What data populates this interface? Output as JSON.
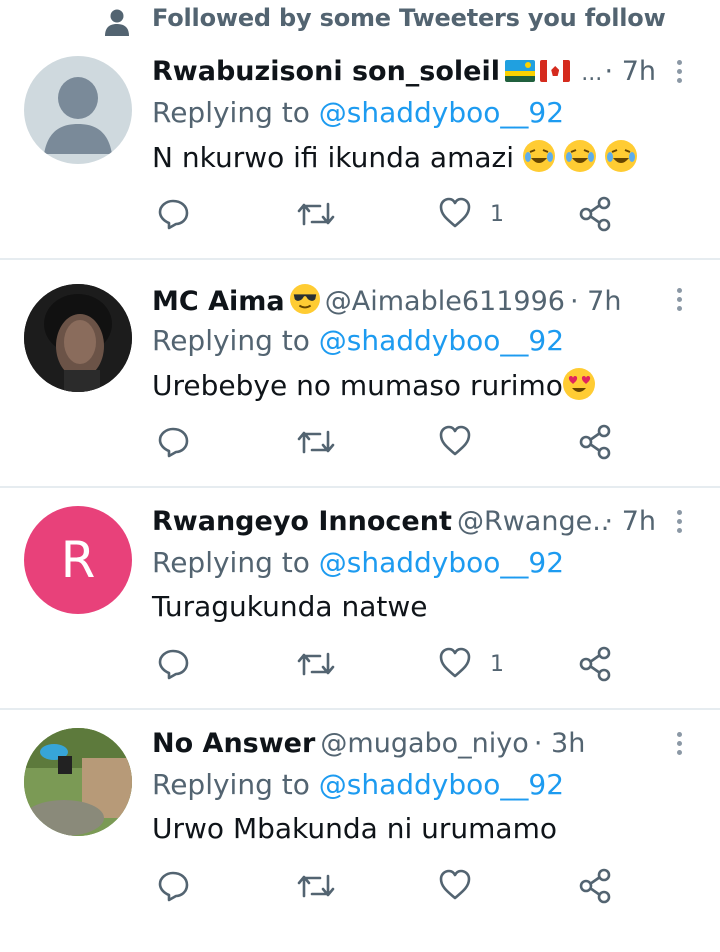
{
  "banner": {
    "text": "Followed by some Tweeters you follow",
    "icon": "person-icon"
  },
  "colors": {
    "link": "#1d9bf0",
    "secondary": "#536471",
    "primary": "#0f1419",
    "divider": "#e6ecf0"
  },
  "tweets": [
    {
      "name": "Rwabuzisoni son_soleil",
      "handle": "",
      "ellipsis": "...",
      "time": "· 7h",
      "reply_prefix": "Replying to",
      "reply_to": "@shaddyboo__92",
      "body": "N nkurwo ifi ikunda amazi",
      "body_emoji": "face-with-tears-of-joy x3",
      "name_emoji": "rwanda-flag, canada-flag",
      "avatar": "default-avatar",
      "likes": "1"
    },
    {
      "name": "MC Aima",
      "handle": "@Aimable611996",
      "time": "· 7h",
      "reply_prefix": "Replying to",
      "reply_to": "@shaddyboo__92",
      "body": "Urebebye no mumaso rurimo",
      "body_emoji": "heart-eyes",
      "name_emoji": "sunglasses",
      "avatar": "photo-avatar",
      "likes": ""
    },
    {
      "name": "Rwangeyo Innocent",
      "handle": "@Rwange...",
      "time": "· 7h",
      "reply_prefix": "Replying to",
      "reply_to": "@shaddyboo__92",
      "body": "Turagukunda natwe",
      "avatar": "letter-avatar",
      "avatar_letter": "R",
      "avatar_color": "#e8417a",
      "likes": "1"
    },
    {
      "name": "No Answer",
      "handle": "@mugabo_niyo",
      "time": "· 3h",
      "reply_prefix": "Replying to",
      "reply_to": "@shaddyboo__92",
      "body": "Urwo Mbakunda ni urumamo",
      "avatar": "photo-avatar",
      "likes": ""
    }
  ]
}
